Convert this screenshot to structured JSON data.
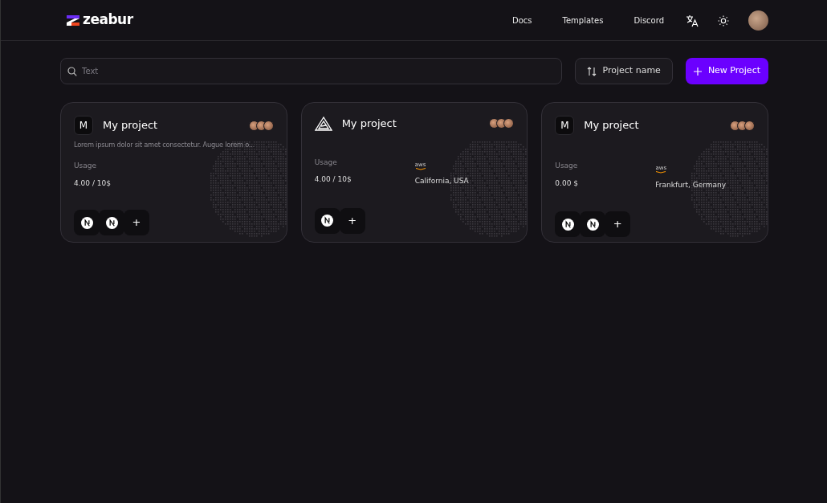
{
  "header": {
    "logo_text": "zeabur",
    "nav": [
      "Docs",
      "Templates",
      "Discord"
    ]
  },
  "toolbar": {
    "search": {
      "placeholder": "Text"
    },
    "sort_button": "Project name",
    "new_button": "New Project"
  },
  "projects": [
    {
      "icon": {
        "kind": "letter",
        "text": "M"
      },
      "title": "My project",
      "description": "Lorem ipsum dolor sit amet consectetur. Augue lorem o...",
      "usage_label": "Usage",
      "usage": "4.00 / 10$",
      "services": [
        {
          "kind": "service"
        },
        {
          "kind": "service"
        },
        {
          "kind": "add",
          "text": "+"
        }
      ]
    },
    {
      "icon": {
        "kind": "triangle"
      },
      "title": "My project",
      "usage_label": "Usage",
      "usage": "4.00 / 10$",
      "provider": "aws",
      "region": "California, USA",
      "services": [
        {
          "kind": "service"
        },
        {
          "kind": "add",
          "text": "+"
        }
      ]
    },
    {
      "icon": {
        "kind": "letter",
        "text": "M"
      },
      "title": "My project",
      "usage_label": "Usage",
      "usage": "0.00 $",
      "provider": "aws",
      "region": "Frankfurt, Germany",
      "services": [
        {
          "kind": "service"
        },
        {
          "kind": "service"
        },
        {
          "kind": "add",
          "text": "+"
        }
      ]
    }
  ]
}
